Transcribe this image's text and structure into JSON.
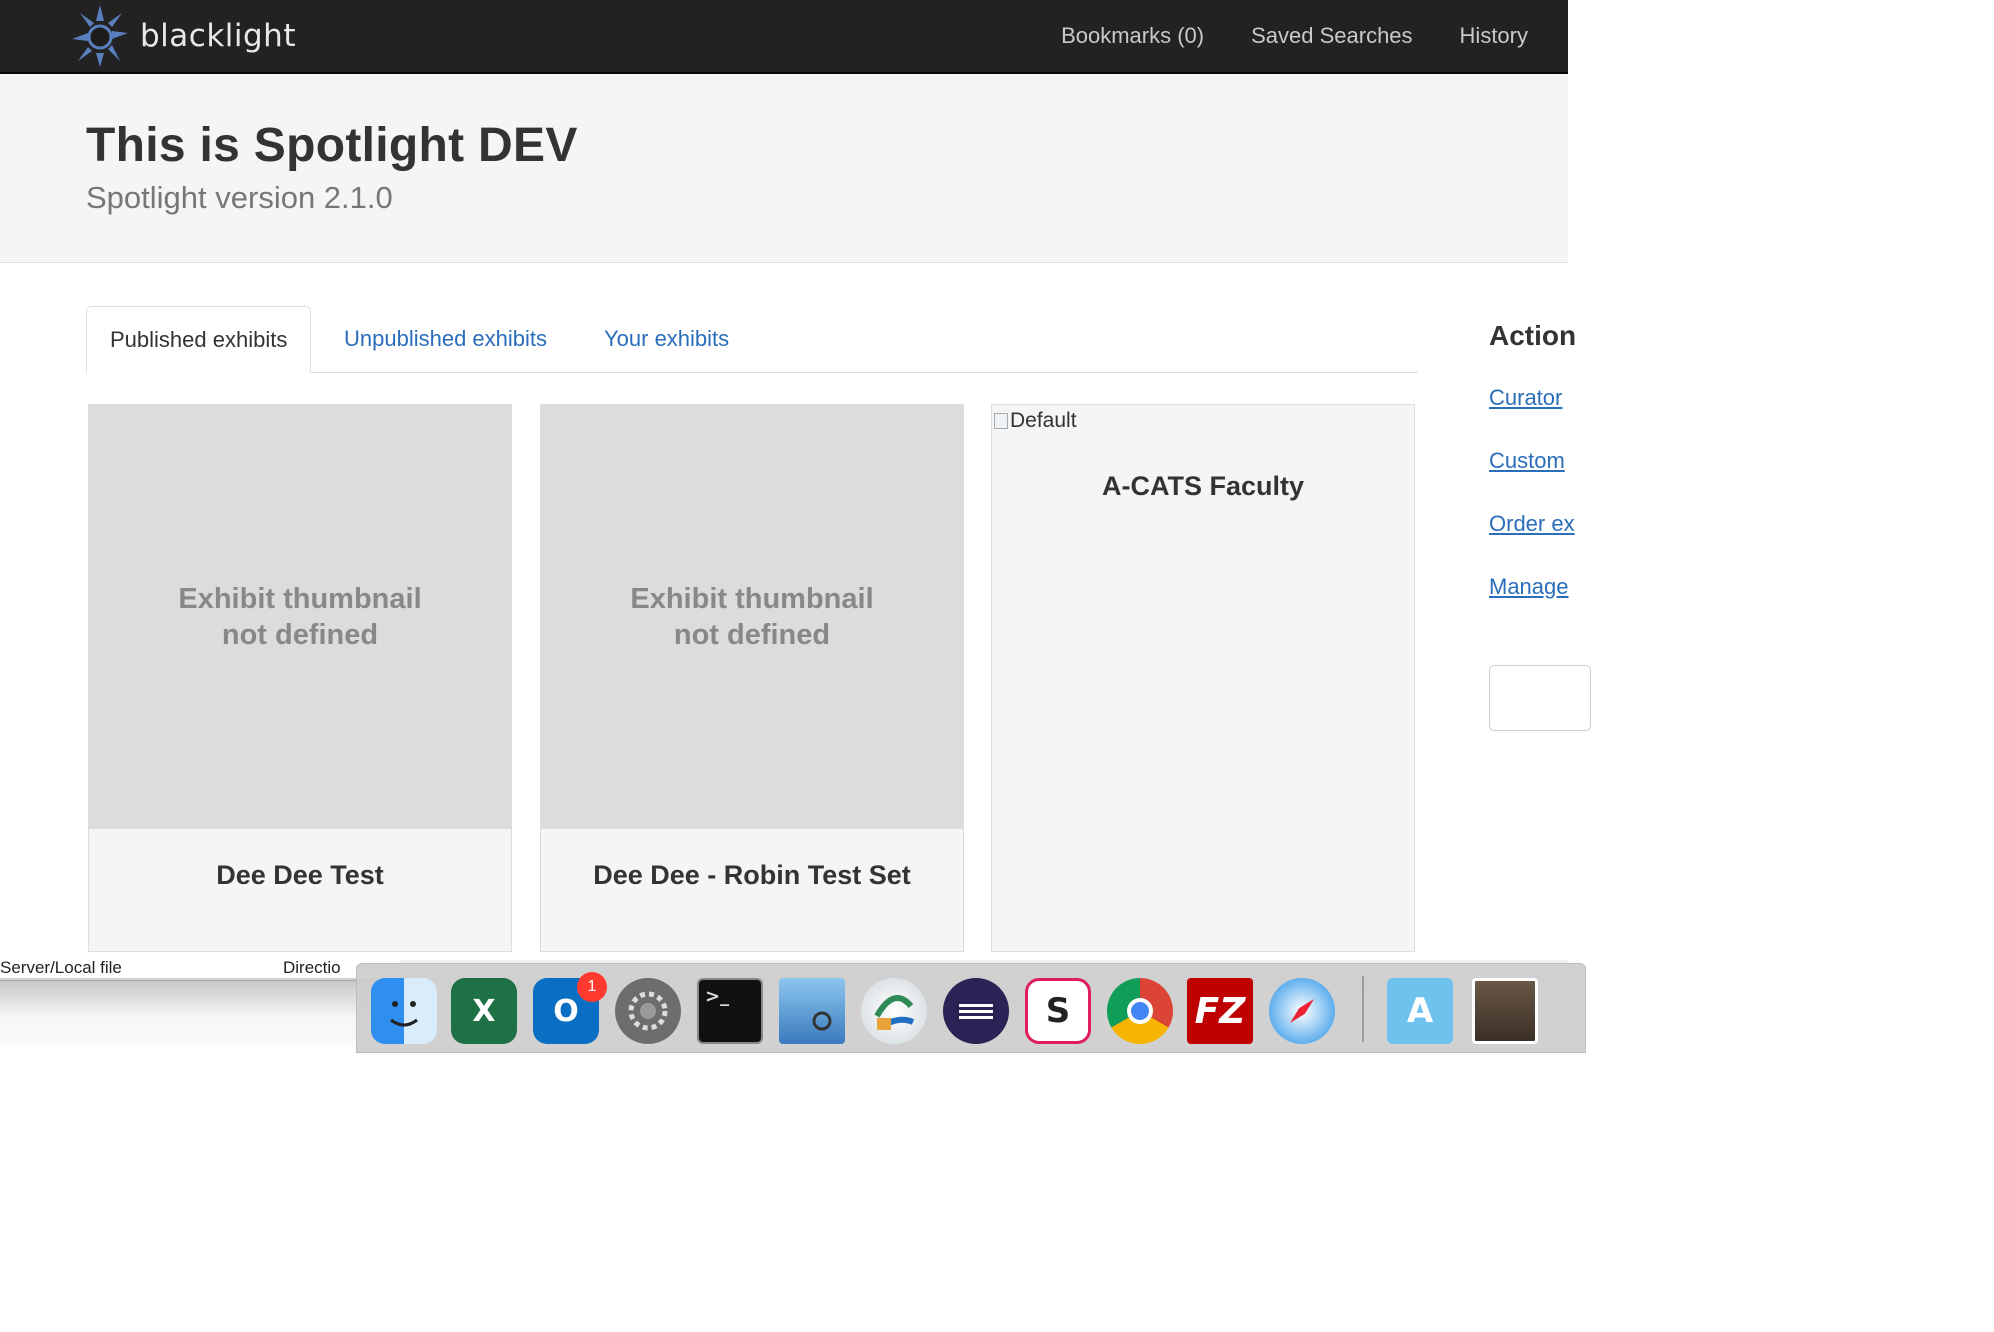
{
  "navbar": {
    "brand": "blacklight",
    "links": [
      "Bookmarks (0)",
      "Saved Searches",
      "History"
    ]
  },
  "masthead": {
    "title": "This is Spotlight DEV",
    "subtitle": "Spotlight version 2.1.0"
  },
  "tabs": [
    {
      "label": "Published exhibits",
      "active": true
    },
    {
      "label": "Unpublished exhibits",
      "active": false
    },
    {
      "label": "Your exhibits",
      "active": false
    }
  ],
  "exhibits": [
    {
      "thumbnail_text_1": "Exhibit thumbnail",
      "thumbnail_text_2": "not defined",
      "title": "Dee Dee Test"
    },
    {
      "thumbnail_text_1": "Exhibit thumbnail",
      "thumbnail_text_2": "not defined",
      "title": "Dee Dee - Robin Test Set"
    },
    {
      "image_alt": "Default",
      "title": "A-CATS Faculty"
    }
  ],
  "actions": {
    "heading": "Action",
    "items": [
      "Curator",
      "Custom",
      "Order ex",
      "Manage"
    ]
  },
  "background_app": {
    "columns": [
      "Server/Local file",
      "Directio"
    ]
  },
  "dock": {
    "icons": [
      "finder",
      "excel",
      "outlook",
      "system-preferences",
      "terminal",
      "preview",
      "vpn-client",
      "eclipse",
      "slack",
      "chrome",
      "filezilla",
      "safari",
      "applications-folder",
      "photo"
    ],
    "outlook_badge": "1"
  },
  "colors": {
    "navbar": "#222222",
    "link": "#2a6ebb",
    "masthead": "#f5f5f5"
  }
}
